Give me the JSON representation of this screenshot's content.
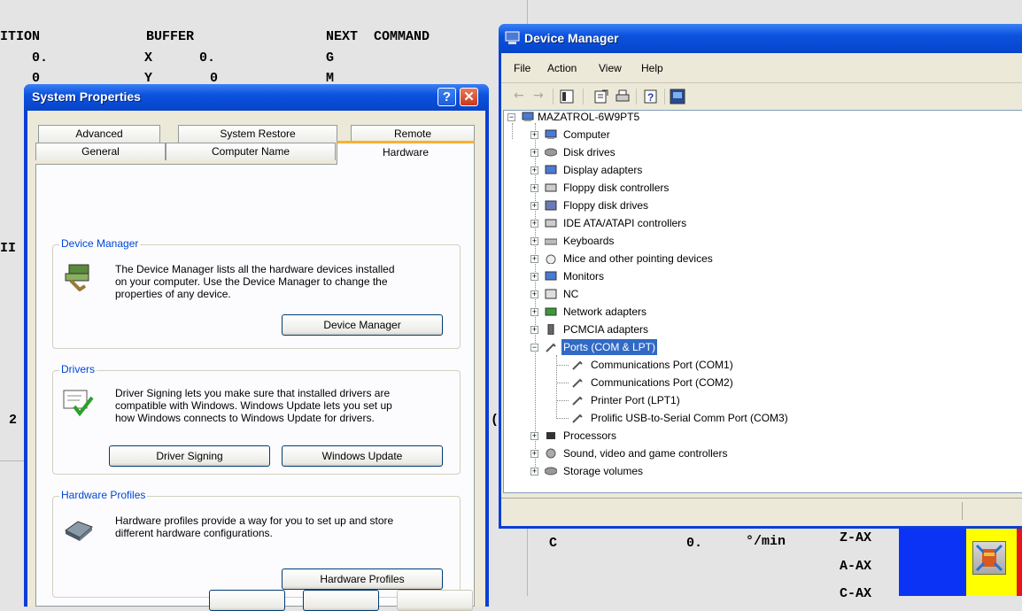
{
  "cnc": {
    "hdr_position": "ITION",
    "hdr_buffer": "BUFFER",
    "hdr_next": "NEXT  COMMAND",
    "pos_row1": "0.",
    "buf_x": "X",
    "buf_x_val": "0.",
    "next_g": "G",
    "pos_row2": "0",
    "buf_y": "Y",
    "buf_y_val": "0",
    "next_m": "M",
    "left_code": "II",
    "left_num": "2",
    "mid_mark": "(",
    "feed_axis": "C",
    "feed_val": "0.",
    "feed_unit": "°/min",
    "axis_z": "Z-AX",
    "axis_a": "A-AX",
    "axis_c": "C-AX",
    "colors": {
      "bar": "#0b33f5",
      "yellow": "#ffff00",
      "red": "#e8141a"
    }
  },
  "system_properties": {
    "title": "System Properties",
    "help_btn": "?",
    "close_btn": "✕",
    "tabs_back": [
      "Advanced",
      "System Restore",
      "Remote"
    ],
    "tabs_front": [
      "General",
      "Computer Name",
      "Hardware"
    ],
    "device_manager": {
      "label": "Device Manager",
      "text": [
        "The Device Manager lists all the hardware devices installed",
        "on your computer. Use the Device Manager to change the",
        "properties of any device."
      ],
      "button": "Device Manager"
    },
    "drivers": {
      "label": "Drivers",
      "text": [
        "Driver Signing lets you make sure that installed drivers are",
        "compatible with Windows. Windows Update lets you set up",
        "how Windows connects to Windows Update for drivers."
      ],
      "button_signing": "Driver Signing",
      "button_update": "Windows Update"
    },
    "hardware_profiles": {
      "label": "Hardware Profiles",
      "text": [
        "Hardware profiles provide a way for you to set up and store",
        "different hardware configurations."
      ],
      "button": "Hardware Profiles"
    }
  },
  "device_manager": {
    "title": "Device Manager",
    "menu": [
      "File",
      "Action",
      "View",
      "Help"
    ],
    "root": "MAZATROL-6W9PT5",
    "categories": [
      "Computer",
      "Disk drives",
      "Display adapters",
      "Floppy disk controllers",
      "Floppy disk drives",
      "IDE ATA/ATAPI controllers",
      "Keyboards",
      "Mice and other pointing devices",
      "Monitors",
      "NC",
      "Network adapters",
      "PCMCIA adapters",
      "Ports (COM & LPT)"
    ],
    "ports": [
      "Communications Port (COM1)",
      "Communications Port (COM2)",
      "Printer Port (LPT1)",
      "Prolific USB-to-Serial Comm Port (COM3)"
    ],
    "categories_after": [
      "Processors",
      "Sound, video and game controllers",
      "Storage volumes"
    ]
  }
}
